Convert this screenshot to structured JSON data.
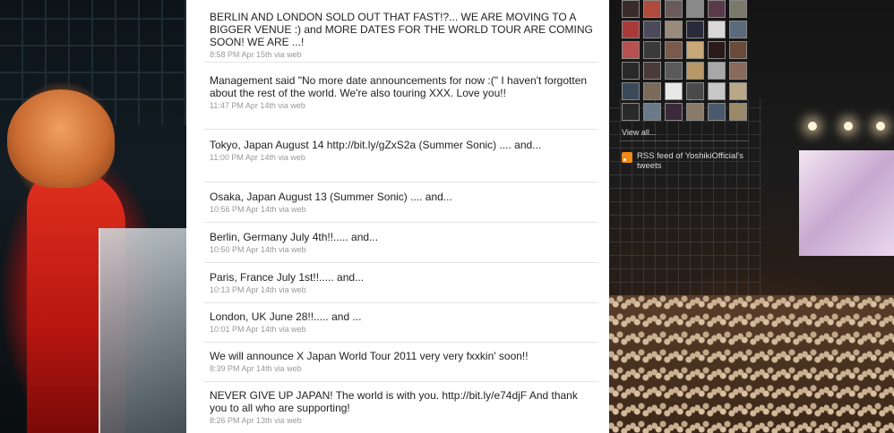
{
  "timeline": {
    "tweets": [
      {
        "text": "BERLIN AND LONDON SOLD OUT THAT FAST!?... WE ARE MOVING TO A BIGGER VENUE :) and MORE DATES FOR THE WORLD TOUR ARE COMING SOON! WE ARE ...!",
        "time": "8:58 PM Apr 15th",
        "source": "via web"
      },
      {
        "text": "Management said \"No more date announcements for now :(\" I haven't forgotten about the rest of the world. We're also touring XXX. Love you!!",
        "time": "11:47 PM Apr 14th",
        "source": "via web"
      },
      {
        "text": "Tokyo, Japan August 14 http://bit.ly/gZxS2a (Summer Sonic) .... and...",
        "time": "11:00 PM Apr 14th",
        "source": "via web"
      },
      {
        "text": "Osaka, Japan August 13 (Summer Sonic) .... and...",
        "time": "10:56 PM Apr 14th",
        "source": "via web"
      },
      {
        "text": "Berlin, Germany July 4th!!..... and...",
        "time": "10:50 PM Apr 14th",
        "source": "via web"
      },
      {
        "text": "Paris, France July 1st!!..... and...",
        "time": "10:13 PM Apr 14th",
        "source": "via web"
      },
      {
        "text": "London, UK June 28!!..... and ...",
        "time": "10:01 PM Apr 14th",
        "source": "via web"
      },
      {
        "text": "We will announce X Japan World Tour 2011 very very fxxkin' soon!!",
        "time": "8:39 PM Apr 14th",
        "source": "via web"
      },
      {
        "text": "NEVER GIVE UP JAPAN! The world is with you. http://bit.ly/e74djF And thank you to all who are supporting!",
        "time": "8:26 PM Apr 13th",
        "source": "via web"
      }
    ]
  },
  "sidebar": {
    "view_all": "View all...",
    "rss_text": "RSS feed of YoshikiOfficial's tweets",
    "avatar_colors": [
      "#3a2a2a",
      "#b04a3a",
      "#6a5a5a",
      "#8a8a8a",
      "#5a3a4a",
      "#7a7a6a",
      "#a83a3a",
      "#4a4a5a",
      "#9a8a7a",
      "#2a2a3a",
      "#d8d8d8",
      "#5a6a7a",
      "#b85050",
      "#3a3a3a",
      "#7a5a4a",
      "#c8a878",
      "#2a1a1a",
      "#6a4a3a",
      "#2a2a2a",
      "#4a3a3a",
      "#5a5a5a",
      "#b89868",
      "#a8a8a8",
      "#8a6a5a",
      "#3a4a5a",
      "#7a6a5a",
      "#e8e8e8",
      "#4a4a4a",
      "#c8c8c8",
      "#b8a888",
      "#2a2a2a",
      "#6a7a8a",
      "#3a2a3a",
      "#8a7a6a",
      "#4a5a6a",
      "#9a8a6a"
    ]
  },
  "colors": {
    "accent_rss": "#f28a1a",
    "meta": "#999999"
  }
}
